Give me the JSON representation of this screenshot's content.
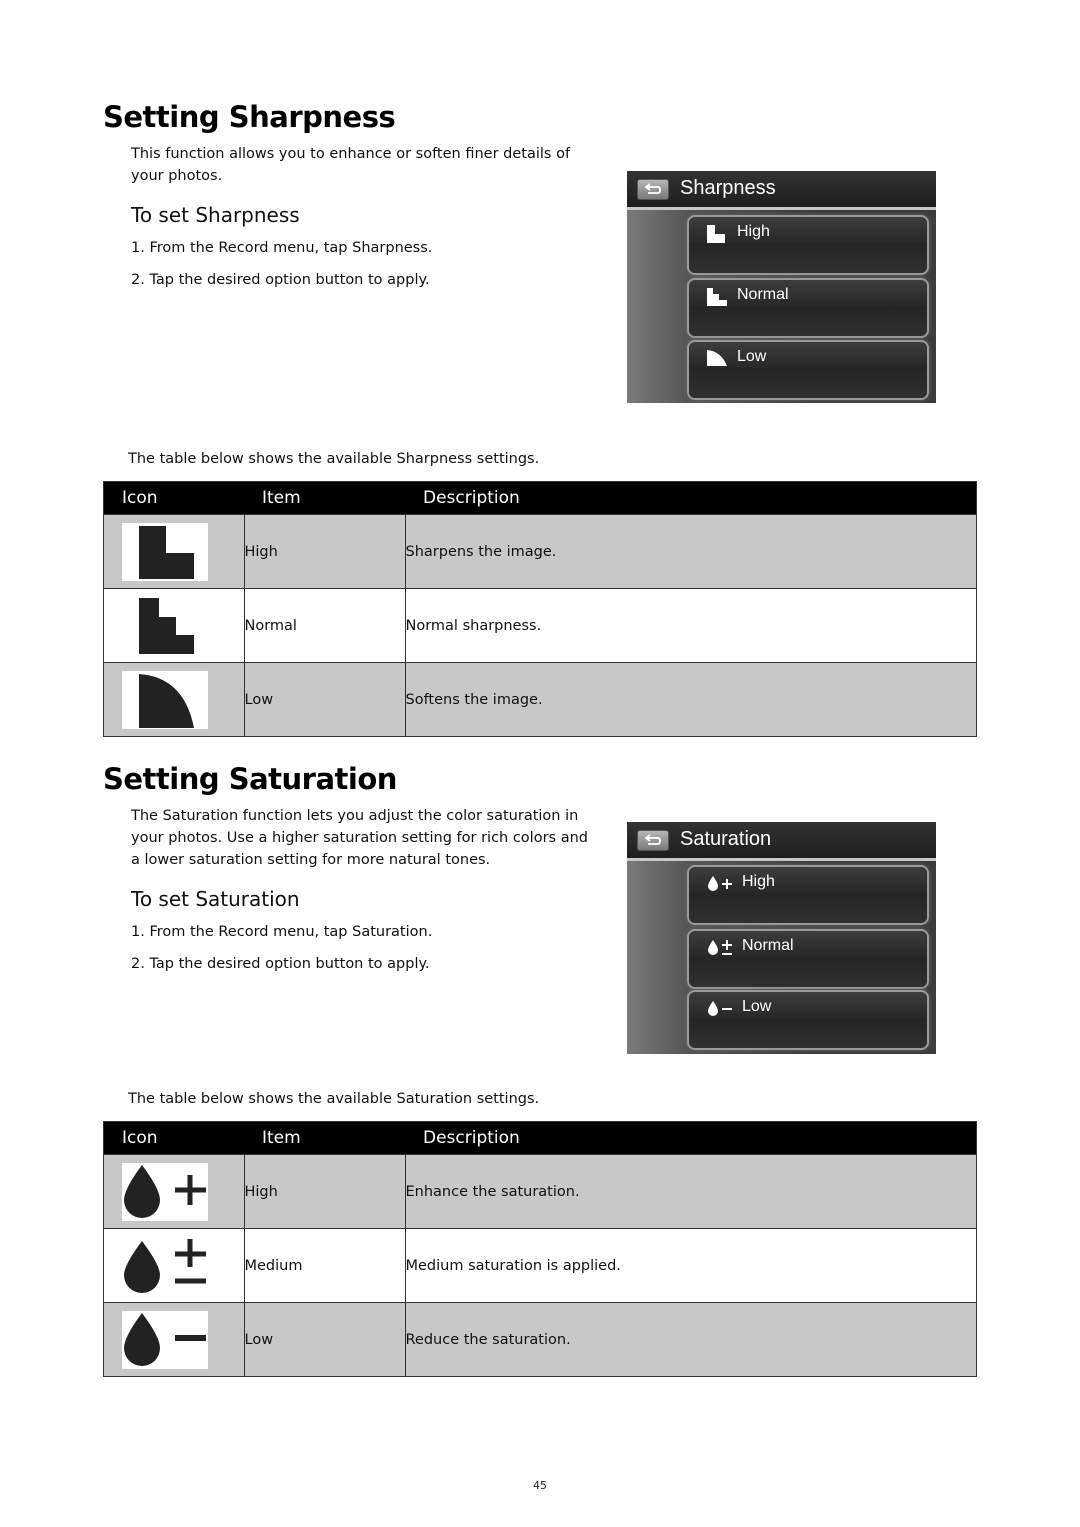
{
  "page_number": "45",
  "sharpness": {
    "heading": "Setting Sharpness",
    "intro": "This function allows you to enhance or soften finer details of your photos.",
    "subheading": "To set Sharpness",
    "steps": [
      "1. From the Record menu, tap Sharpness.",
      "2. Tap the desired option button to apply."
    ],
    "screen": {
      "title": "Sharpness",
      "back_icon": "back-arrow-icon",
      "options": [
        {
          "label": "High",
          "icon": "sharpness-high-icon"
        },
        {
          "label": "Normal",
          "icon": "sharpness-normal-icon"
        },
        {
          "label": "Low",
          "icon": "sharpness-low-icon"
        }
      ]
    },
    "table_note": "The table below shows the available Sharpness settings.",
    "table": {
      "headers": [
        "Icon",
        "Item",
        "Description"
      ],
      "rows": [
        {
          "icon": "sharpness-high-icon",
          "item": "High",
          "description": "Sharpens the image."
        },
        {
          "icon": "sharpness-normal-icon",
          "item": "Normal",
          "description": "Normal sharpness."
        },
        {
          "icon": "sharpness-low-icon",
          "item": "Low",
          "description": "Softens the image."
        }
      ]
    }
  },
  "saturation": {
    "heading": "Setting Saturation",
    "intro": "The Saturation function lets you adjust the color saturation in your photos. Use a higher saturation setting for rich colors and a lower saturation setting for more natural tones.",
    "subheading": "To set Saturation",
    "steps": [
      "1. From the Record menu, tap Saturation.",
      "2. Tap the desired option button to apply."
    ],
    "screen": {
      "title": "Saturation",
      "back_icon": "back-arrow-icon",
      "options": [
        {
          "label": "High",
          "icon": "saturation-high-icon"
        },
        {
          "label": "Normal",
          "icon": "saturation-normal-icon"
        },
        {
          "label": "Low",
          "icon": "saturation-low-icon"
        }
      ]
    },
    "table_note": "The table below shows the available Saturation settings.",
    "table": {
      "headers": [
        "Icon",
        "Item",
        "Description"
      ],
      "rows": [
        {
          "icon": "saturation-high-icon",
          "item": "High",
          "description": "Enhance the saturation."
        },
        {
          "icon": "saturation-normal-icon",
          "item": "Medium",
          "description": "Medium saturation is applied."
        },
        {
          "icon": "saturation-low-icon",
          "item": "Low",
          "description": "Reduce the saturation."
        }
      ]
    }
  }
}
